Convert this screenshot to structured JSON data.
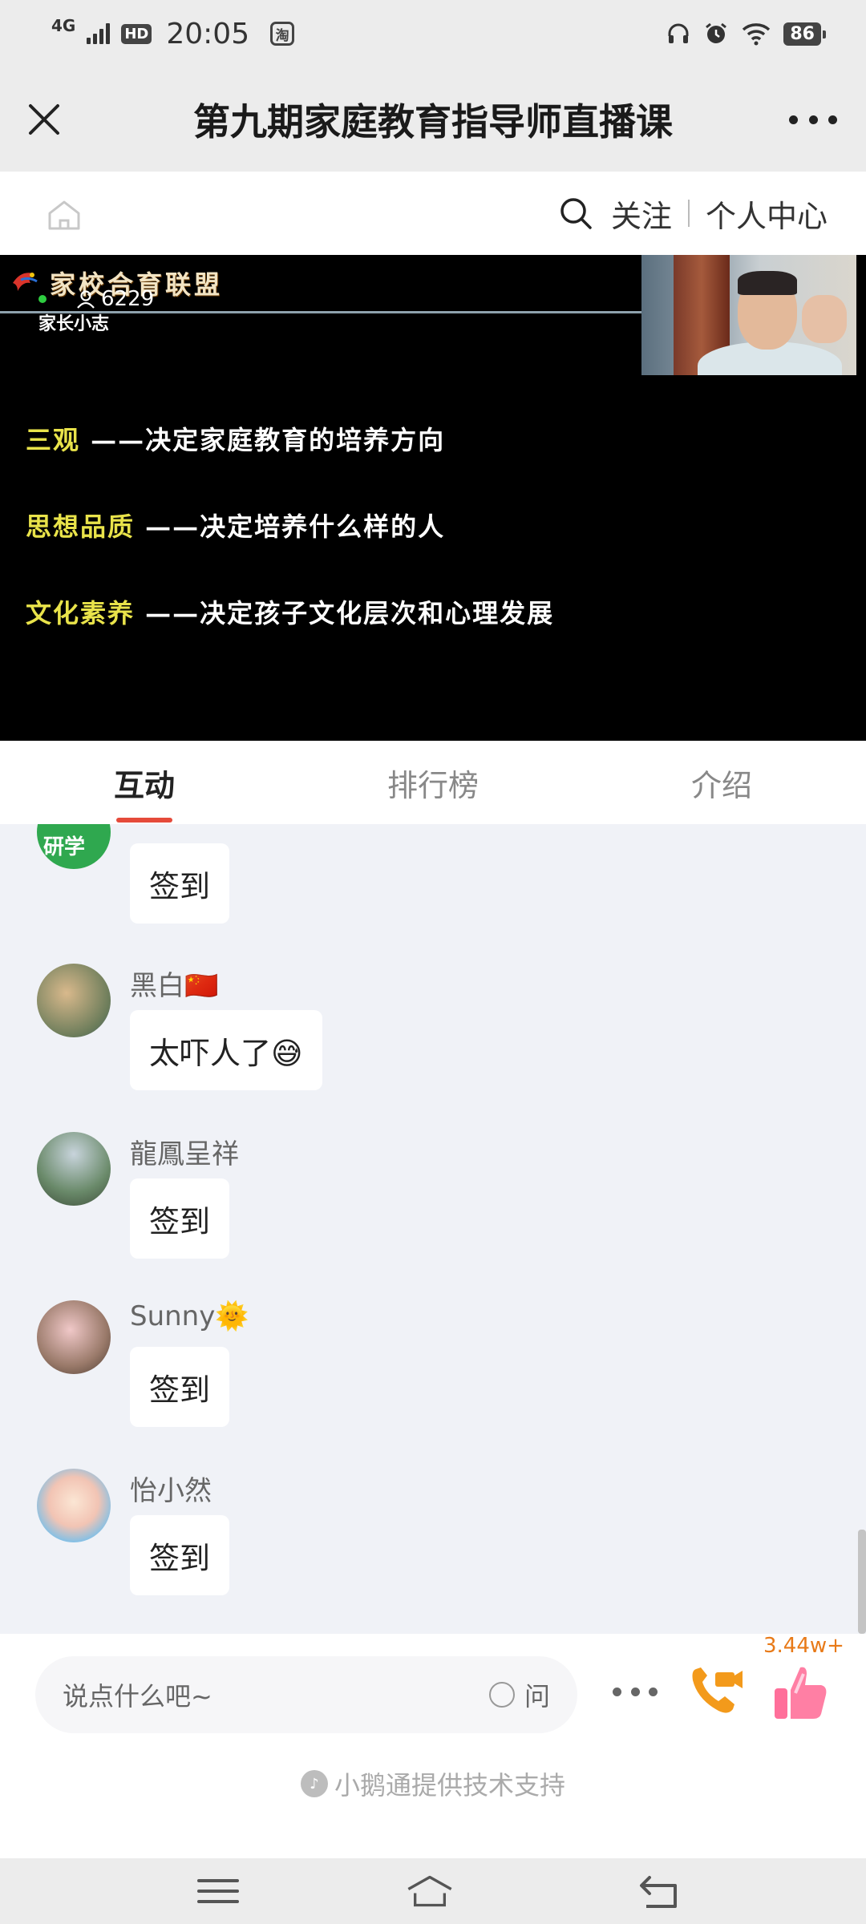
{
  "status_bar": {
    "network": "4G",
    "hd": "HD",
    "time": "20:05",
    "app_badge": "淘",
    "battery": "86"
  },
  "header": {
    "title": "第九期家庭教育指导师直播课"
  },
  "subnav": {
    "follow_label": "关注",
    "profile_label": "个人中心"
  },
  "video": {
    "logo_text": "家校合育联盟",
    "viewer_count": "6229",
    "sub_caption": "家长小志",
    "slide_lines": [
      {
        "key": "三观",
        "text": "——决定家庭教育的培养方向"
      },
      {
        "key": "思想品质",
        "text": "——决定培养什么样的人"
      },
      {
        "key": "文化素养",
        "text": "——决定孩子文化层次和心理发展"
      }
    ]
  },
  "tabs": [
    {
      "label": "互动",
      "active": true
    },
    {
      "label": "排行榜",
      "active": false
    },
    {
      "label": "介绍",
      "active": false
    }
  ],
  "chat": {
    "messages": [
      {
        "nickname": "",
        "avatar_text": "研学",
        "text": "签到"
      },
      {
        "nickname": "黑白🇨🇳",
        "text": "太吓人了😅"
      },
      {
        "nickname": "龍鳳呈祥",
        "text": "签到"
      },
      {
        "nickname": "Sunny🌞",
        "text": "签到"
      },
      {
        "nickname": "怡小然",
        "text": "签到"
      }
    ]
  },
  "bottom": {
    "input_placeholder": "说点什么吧~",
    "ask_label": "问",
    "like_count": "3.44w+",
    "powered_by": "小鹅通提供技术支持"
  },
  "colors": {
    "accent": "#e54a3a",
    "slide_key": "#e9e34a",
    "like_count": "#e87a18"
  }
}
